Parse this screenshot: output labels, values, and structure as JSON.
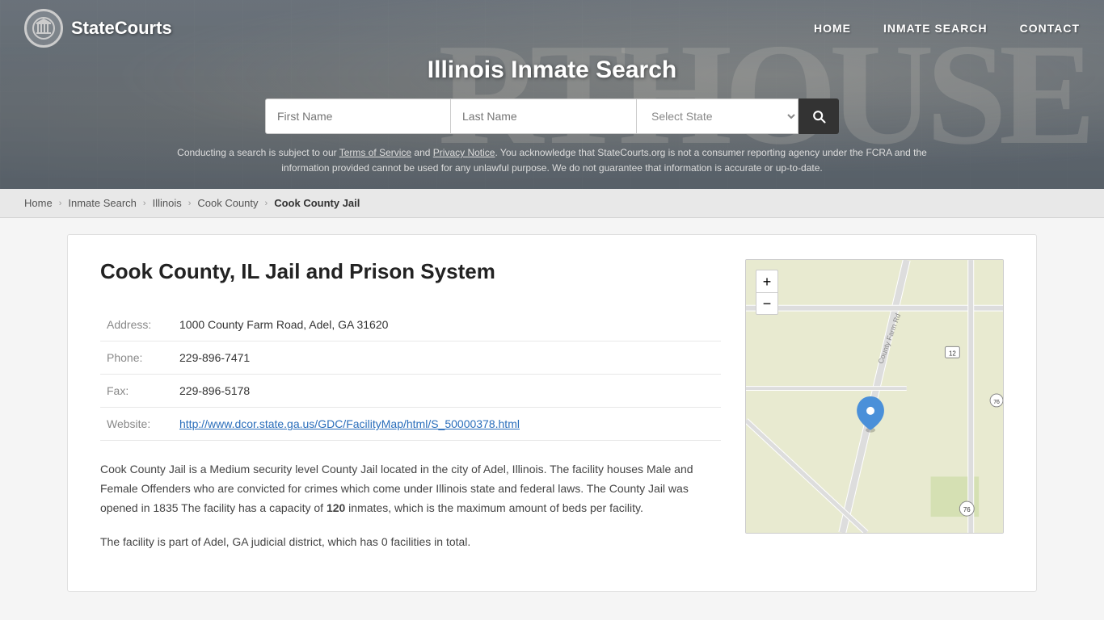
{
  "site": {
    "logo_text": "StateCourts",
    "logo_icon": "courthouse-icon"
  },
  "nav": {
    "home": "HOME",
    "inmate_search": "INMATE SEARCH",
    "contact": "CONTACT"
  },
  "hero": {
    "title": "Illinois Inmate Search",
    "bg_letters": "RTHOUSE"
  },
  "search": {
    "first_name_placeholder": "First Name",
    "last_name_placeholder": "Last Name",
    "state_default": "Select State",
    "search_icon": "search-icon"
  },
  "disclaimer": {
    "text_before": "Conducting a search is subject to our ",
    "terms_label": "Terms of Service",
    "and": " and ",
    "privacy_label": "Privacy Notice",
    "text_after": ". You acknowledge that StateCourts.org is not a consumer reporting agency under the FCRA and the information provided cannot be used for any unlawful purpose. We do not guarantee that information is accurate or up-to-date."
  },
  "breadcrumb": {
    "home": "Home",
    "inmate_search": "Inmate Search",
    "illinois": "Illinois",
    "cook_county": "Cook County",
    "current": "Cook County Jail"
  },
  "facility": {
    "title": "Cook County, IL Jail and Prison System",
    "address_label": "Address:",
    "address_value": "1000 County Farm Road, Adel, GA 31620",
    "phone_label": "Phone:",
    "phone_value": "229-896-7471",
    "fax_label": "Fax:",
    "fax_value": "229-896-5178",
    "website_label": "Website:",
    "website_value": "http://www.dcor.state.ga.us/GDC/FacilityMap/html/S_50000378.html",
    "description1": "Cook County Jail is a Medium security level County Jail located in the city of Adel, Illinois. The facility houses Male and Female Offenders who are convicted for crimes which come under Illinois state and federal laws. The County Jail was opened in 1835 The facility has a capacity of ",
    "capacity": "120",
    "description1b": " inmates, which is the maximum amount of beds per facility.",
    "description2": "The facility is part of Adel, GA judicial district, which has 0 facilities in total."
  },
  "map": {
    "zoom_in": "+",
    "zoom_out": "−",
    "road_label": "County Farm Rd"
  }
}
